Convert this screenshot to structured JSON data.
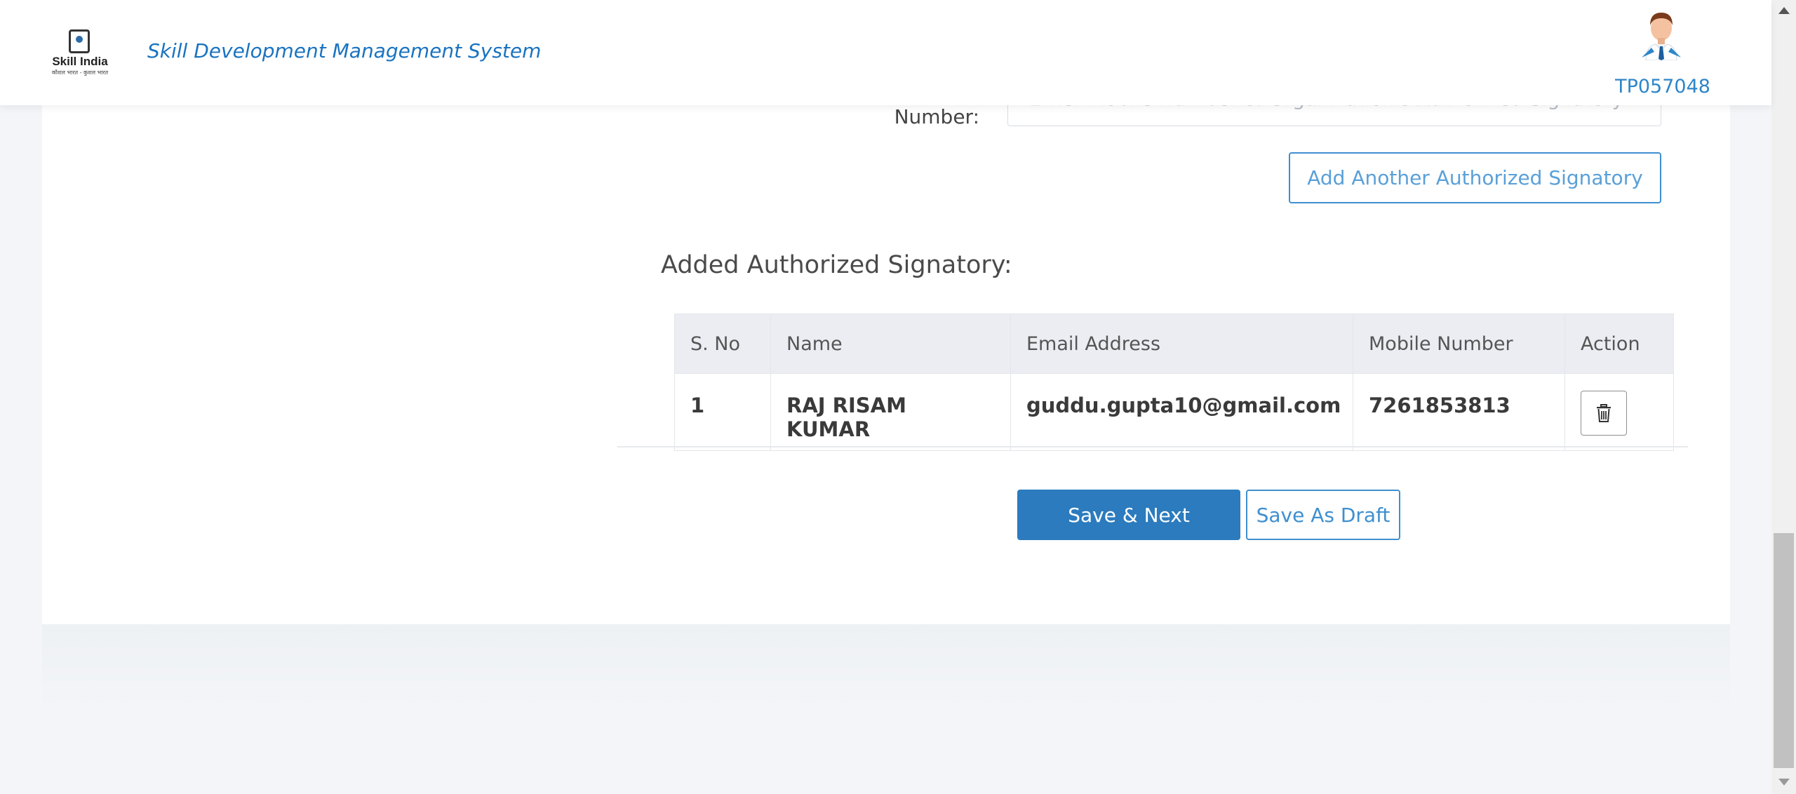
{
  "header": {
    "logo_name": "Skill India",
    "logo_tagline": "कौशल भारत - कुशल भारत",
    "app_title": "Skill Development Management System",
    "user_id": "TP057048"
  },
  "form": {
    "mobile_label_partial": "g y",
    "mobile_label": "Number:",
    "mobile_placeholder": "Enter Mobile Number of Organization's Authorized Signatory",
    "add_button": "Add Another Authorized Signatory"
  },
  "signatories": {
    "title": "Added Authorized Signatory:",
    "columns": [
      "S. No",
      "Name",
      "Email Address",
      "Mobile Number",
      "Action"
    ],
    "rows": [
      {
        "sno": "1",
        "name": "RAJ RISAM KUMAR",
        "email": "guddu.gupta10@gmail.com",
        "mobile": "7261853813"
      }
    ]
  },
  "actions": {
    "save_next": "Save & Next",
    "save_draft": "Save As Draft"
  },
  "colors": {
    "primary": "#2b7bbe",
    "link": "#1a73c0",
    "outline": "#3f8fd0"
  },
  "icons": {
    "delete": "trash-icon",
    "avatar": "user-avatar-icon"
  }
}
